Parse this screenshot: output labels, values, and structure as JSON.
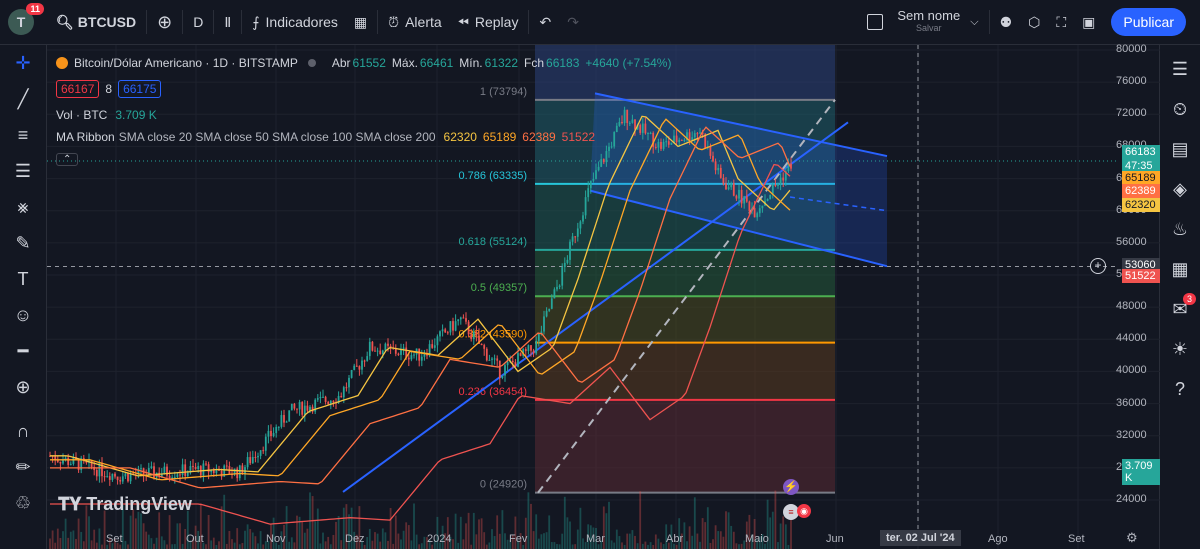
{
  "topbar": {
    "avatar_letter": "T",
    "avatar_badge": "11",
    "symbol": "BTCUSD",
    "interval": "D",
    "indicators": "Indicadores",
    "alert": "Alerta",
    "replay": "Replay",
    "layout_name": "Sem nome",
    "layout_status": "Salvar",
    "publish": "Publicar"
  },
  "legend": {
    "title": "Bitcoin/Dólar Americano · 1D · BITSTAMP",
    "open_label": "Abr",
    "open": "61552",
    "high_label": "Máx.",
    "high": "66461",
    "low_label": "Mín.",
    "low": "61322",
    "close_label": "Fch",
    "close": "66183",
    "change": "+4640 (+7.54%)",
    "bid": "66167",
    "spread": "8",
    "ask": "66175",
    "vol_label": "Vol · BTC",
    "vol": "3.709 K",
    "ma_name": "MA Ribbon",
    "ma_params": "SMA close 20 SMA close 50 SMA close 100 SMA close 200",
    "ma_values": [
      "62320",
      "65189",
      "62389",
      "51522"
    ]
  },
  "fib_levels": [
    {
      "label": "1 (73794)",
      "value": 73794,
      "color": "#787b86"
    },
    {
      "label": "0.786 (63335)",
      "value": 63335,
      "color": "#26c6da"
    },
    {
      "label": "0.618 (55124)",
      "value": 55124,
      "color": "#26a69a"
    },
    {
      "label": "0.5 (49357)",
      "value": 49357,
      "color": "#4caf50"
    },
    {
      "label": "0.382 (43590)",
      "value": 43590,
      "color": "#ff9800"
    },
    {
      "label": "0.236 (36454)",
      "value": 36454,
      "color": "#f23645"
    },
    {
      "label": "0 (24920)",
      "value": 24920,
      "color": "#787b86"
    }
  ],
  "price_axis": [
    "80000",
    "76000",
    "72000",
    "68000",
    "64000",
    "60000",
    "56000",
    "52000",
    "48000",
    "44000",
    "40000",
    "36000",
    "32000",
    "28000",
    "24000"
  ],
  "price_tags": {
    "last": "66183",
    "countdown": "47:35",
    "ma50": "65189",
    "ma100": "62389",
    "ma20": "62320",
    "crosshair": "53060",
    "ma200": "51522",
    "volume": "3.709 K"
  },
  "time_axis": [
    "Set",
    "Out",
    "Nov",
    "Dez",
    "2024",
    "Fev",
    "Mar",
    "Abr",
    "Maio",
    "Jun",
    "ter. 02 Jul '24",
    "Ago",
    "Set"
  ],
  "watermark": "TradingView",
  "right_badge": "3",
  "colors": {
    "up": "#26a69a",
    "down": "#ef5350",
    "accent": "#2962ff"
  }
}
